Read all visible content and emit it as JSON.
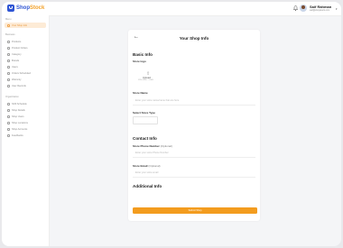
{
  "brand": {
    "name_part1": "Shop",
    "name_part2": "Stock",
    "logo_icon": "bag-icon",
    "primary_color": "#2f55d4",
    "accent_color": "#f39c1f"
  },
  "sidebar": {
    "top_label": "Menu",
    "active_item": "Your Shop Info",
    "section1_label": "Business",
    "section1_items": [
      "Products",
      "Product Orders",
      "Category",
      "Brands",
      "Users",
      "Orders Scheduled",
      "Warranty",
      "User Records"
    ],
    "section2_label": "Organization",
    "section2_items": [
      "Shift Schedule",
      "Shop Details",
      "Shop Users",
      "Shop Locations",
      "Shop Accounts",
      "Feedbacks"
    ]
  },
  "topbar": {
    "user_name": "Saif Rahman",
    "user_email": "saif@shopstock.com"
  },
  "form": {
    "title": "Your Shop Info",
    "basic_info_heading": "Basic Info",
    "store_logo_label": "Store logo",
    "upload_text": "Upload",
    "upload_hint": "JPG,PNG · 5 MB",
    "store_name_label": "Store Name",
    "store_name_placeholder": "Enter your store name/name that are here",
    "store_type_label": "Select Store Type",
    "contact_heading": "Contact Info",
    "phone_label": "Store Phone Number",
    "phone_optional": "(Optional)",
    "phone_placeholder": "Enter your store Phone Number",
    "email_label": "Store Email",
    "email_optional": "(Optional)",
    "email_placeholder": "Enter your store email",
    "additional_heading": "Additional Info",
    "submit_label": "Submit Shop"
  }
}
